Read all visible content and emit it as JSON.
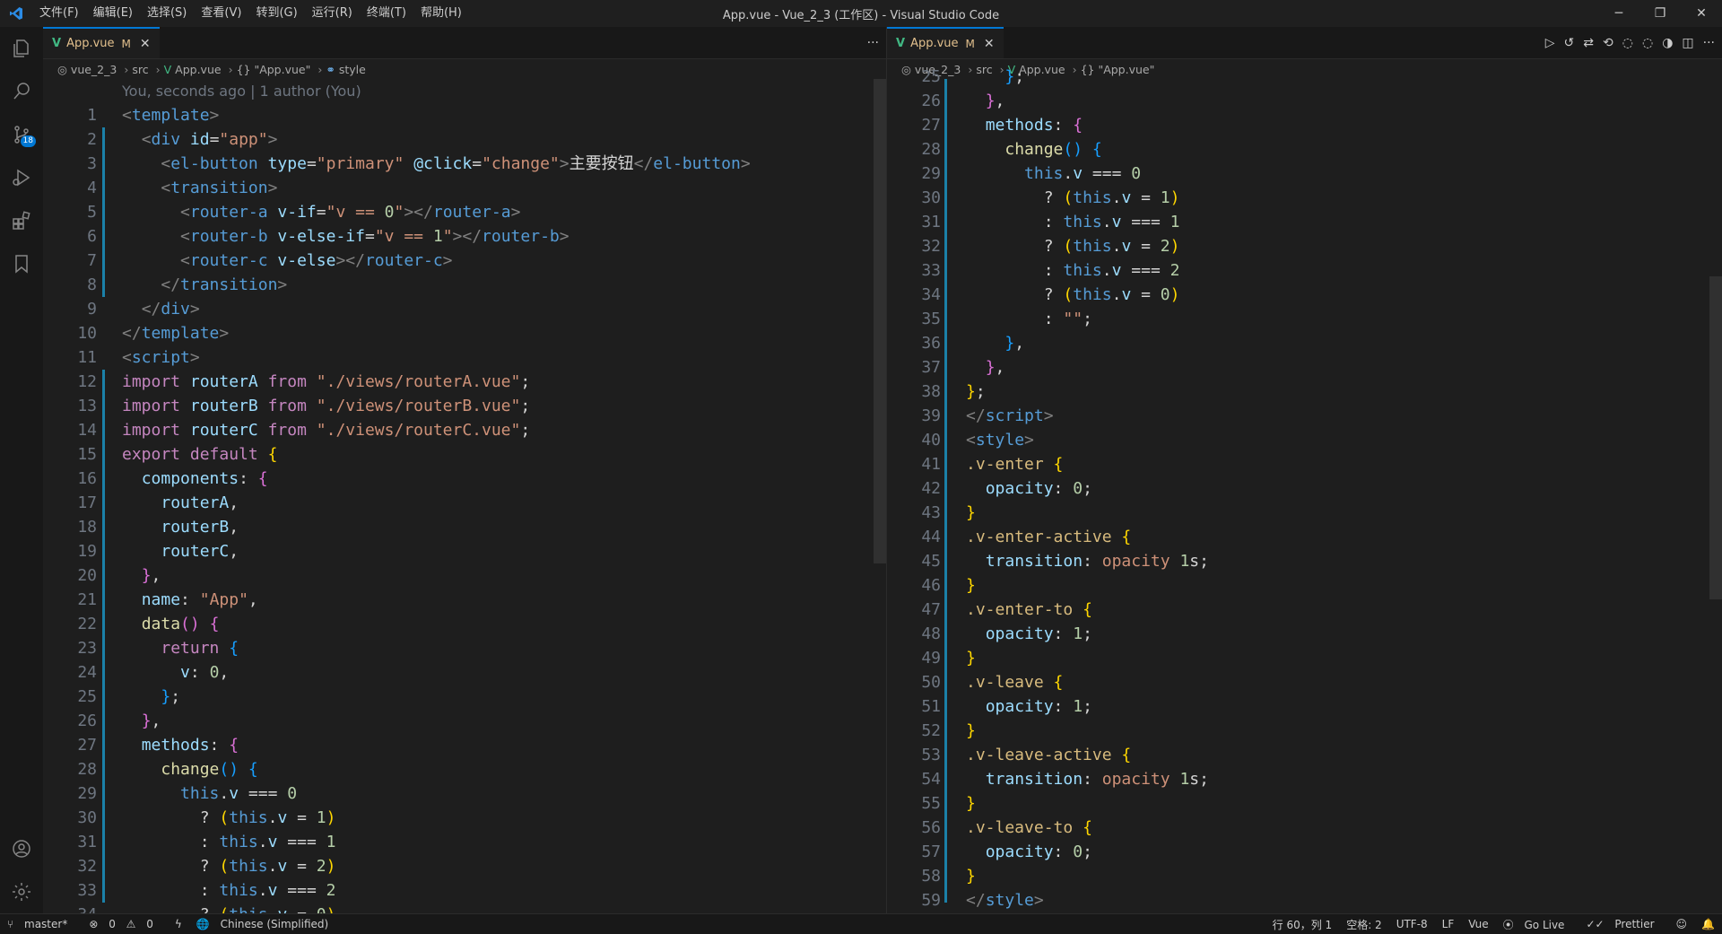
{
  "window": {
    "title": "App.vue - Vue_2_3 (工作区) - Visual Studio Code",
    "menu": [
      "文件(F)",
      "编辑(E)",
      "选择(S)",
      "查看(V)",
      "转到(G)",
      "运行(R)",
      "终端(T)",
      "帮助(H)"
    ],
    "controls": {
      "minimize": "─",
      "restore": "❐",
      "close": "✕"
    }
  },
  "activity_bar": {
    "icons": [
      "explorer-icon",
      "search-icon",
      "source-control-icon",
      "run-debug-icon",
      "extensions-icon",
      "bookmark-icon"
    ],
    "scm_badge": "18",
    "bottom_icons": [
      "account-icon",
      "settings-gear-icon"
    ]
  },
  "left_editor": {
    "tab": {
      "label": "App.vue",
      "modified": "M",
      "close": "✕"
    },
    "more_actions": "···",
    "breadcrumb": [
      "vue_2_3",
      "src",
      "App.vue",
      "{} \"App.vue\"",
      "style"
    ],
    "blame": "You, seconds ago | 1 author (You)"
  },
  "right_editor": {
    "tab": {
      "label": "App.vue",
      "modified": "M",
      "close": "✕"
    },
    "breadcrumb": [
      "vue_2_3",
      "src",
      "App.vue",
      "{} \"App.vue\""
    ]
  },
  "status_bar": {
    "branch": "master*",
    "errors": "0",
    "warnings": "0",
    "language_pack": "Chinese (Simplified)",
    "position": "行 60，列 1",
    "spaces": "空格: 2",
    "encoding": "UTF-8",
    "eol": "LF",
    "language": "Vue",
    "go_live": "Go Live",
    "prettier": "Prettier"
  },
  "code_left_start": 1,
  "code_right_start": 25
}
